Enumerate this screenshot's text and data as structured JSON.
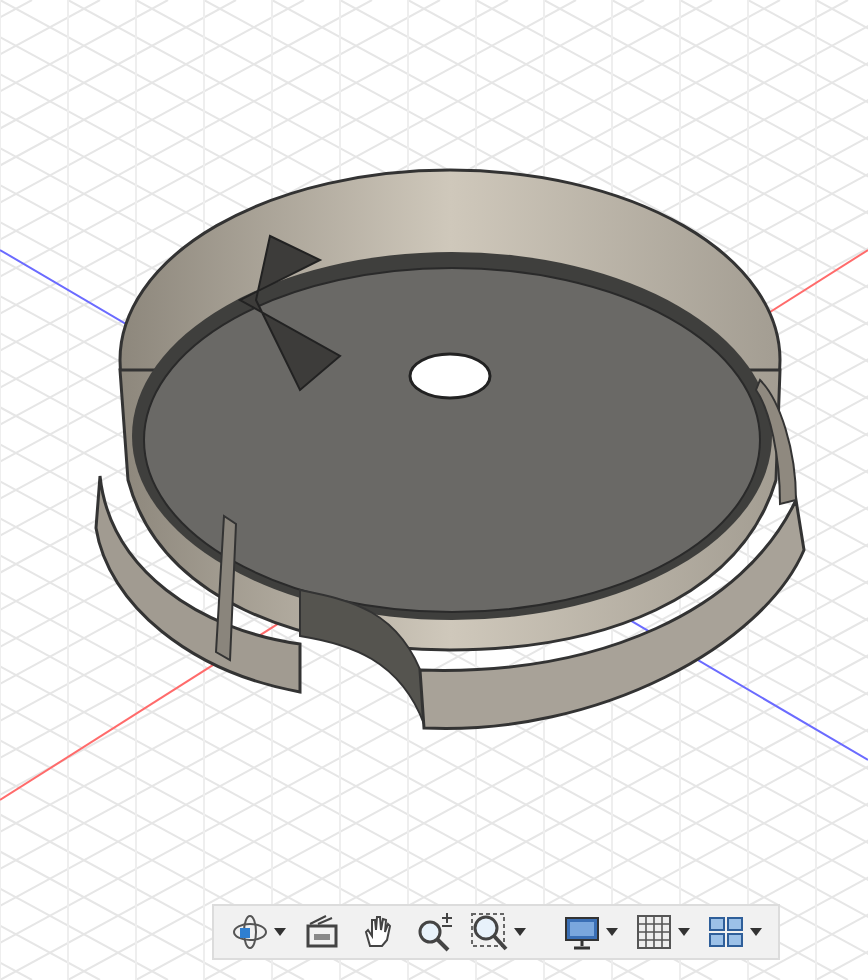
{
  "toolbar": {
    "tools": [
      {
        "kind": "orbit",
        "dropdown": true
      },
      {
        "kind": "look-at",
        "dropdown": false
      },
      {
        "kind": "pan",
        "dropdown": false
      },
      {
        "kind": "zoom",
        "dropdown": false
      },
      {
        "kind": "fit",
        "dropdown": true
      },
      {
        "kind": "display",
        "dropdown": true
      },
      {
        "kind": "grid",
        "dropdown": true
      },
      {
        "kind": "viewports",
        "dropdown": true
      }
    ]
  }
}
